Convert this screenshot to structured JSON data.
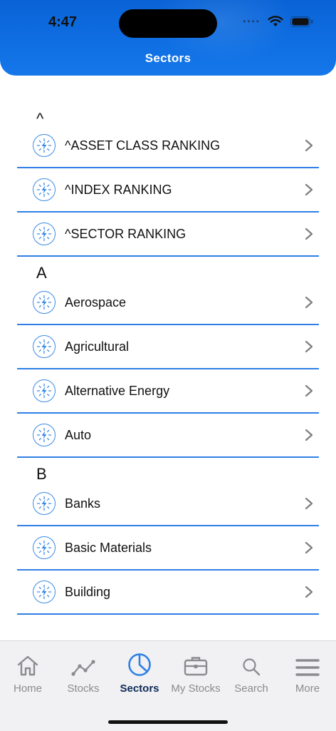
{
  "status": {
    "time": "4:47"
  },
  "header": {
    "title": "Sectors"
  },
  "sections": [
    {
      "letter": "^",
      "items": [
        "^ASSET CLASS RANKING",
        "^INDEX RANKING",
        "^SECTOR RANKING"
      ]
    },
    {
      "letter": "A",
      "items": [
        "Aerospace",
        "Agricultural",
        "Alternative Energy",
        "Auto"
      ]
    },
    {
      "letter": "B",
      "items": [
        "Banks",
        "Basic Materials",
        "Building"
      ]
    }
  ],
  "tabs": [
    {
      "label": "Home",
      "icon": "home-icon"
    },
    {
      "label": "Stocks",
      "icon": "line-chart-icon"
    },
    {
      "label": "Sectors",
      "icon": "pie-chart-icon",
      "active": true
    },
    {
      "label": "My Stocks",
      "icon": "briefcase-icon"
    },
    {
      "label": "Search",
      "icon": "search-icon"
    },
    {
      "label": "More",
      "icon": "menu-icon"
    }
  ],
  "colors": {
    "accent": "#2f7fe6",
    "header": "#0f6fe3",
    "tab_active": "#0b2a55"
  }
}
